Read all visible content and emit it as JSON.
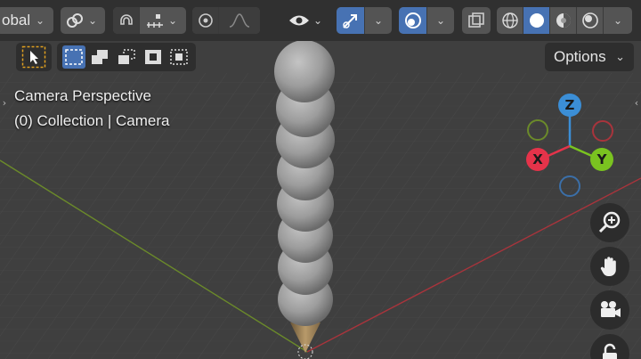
{
  "header": {
    "orientation_label": "obal",
    "snap_icon": "snap-magnet-icon",
    "proportional_icon": "proportional-edit-icon",
    "visibility_icon": "eye-icon",
    "gizmo_icon": "gizmo-arrow-icon",
    "overlay_icon": "overlay-icon",
    "xray_icon": "xray-toggle-icon",
    "shading_modes": [
      "wireframe",
      "solid",
      "material-preview",
      "rendered"
    ],
    "active_shading": "solid",
    "accent_color": "#4772b3"
  },
  "toolbar": {
    "select_modes": [
      "set",
      "extend",
      "subtract",
      "invert",
      "intersect"
    ],
    "active_select_mode": "set",
    "options_label": "Options"
  },
  "viewport": {
    "view_name": "Camera Perspective",
    "collection_label": "(0) Collection | Camera"
  },
  "gizmo": {
    "x_label": "X",
    "y_label": "Y",
    "z_label": "Z",
    "x_color": "#e5334a",
    "y_color": "#7ac320",
    "z_color": "#3b8ed6"
  },
  "nav": {
    "buttons": [
      "zoom-icon",
      "pan-hand-icon",
      "camera-view-icon",
      "lock-icon"
    ]
  }
}
